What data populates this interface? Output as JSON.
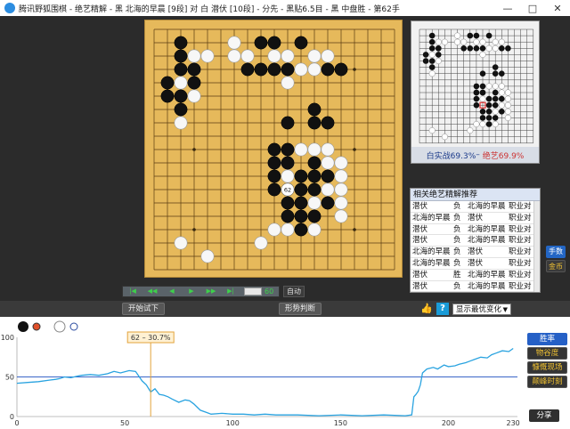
{
  "window": {
    "title": "腾讯野狐围棋 - 绝艺精解 - 黑 北海的早晨 [9段] 对 白 潜伏 [10段] - 分先 - 黑贴6.5目 - 黑 中盘胜 - 第62手",
    "controls": [
      "—",
      "□",
      "✕"
    ]
  },
  "board": {
    "size": 19,
    "star_points": [
      [
        3,
        3
      ],
      [
        3,
        9
      ],
      [
        3,
        15
      ],
      [
        9,
        3
      ],
      [
        9,
        9
      ],
      [
        9,
        15
      ],
      [
        15,
        3
      ],
      [
        15,
        9
      ],
      [
        15,
        15
      ]
    ],
    "black": [
      [
        2,
        1
      ],
      [
        9,
        1
      ],
      [
        2,
        2
      ],
      [
        11,
        1
      ],
      [
        3,
        3
      ],
      [
        2,
        3
      ],
      [
        1,
        4
      ],
      [
        3,
        4
      ],
      [
        1,
        5
      ],
      [
        2,
        5
      ],
      [
        2,
        6
      ],
      [
        7,
        3
      ],
      [
        8,
        3
      ],
      [
        9,
        3
      ],
      [
        10,
        3
      ],
      [
        13,
        3
      ],
      [
        14,
        3
      ],
      [
        12,
        6
      ],
      [
        10,
        7
      ],
      [
        12,
        7
      ],
      [
        13,
        7
      ],
      [
        9,
        9
      ],
      [
        10,
        9
      ],
      [
        9,
        10
      ],
      [
        10,
        10
      ],
      [
        12,
        10
      ],
      [
        9,
        11
      ],
      [
        11,
        11
      ],
      [
        12,
        11
      ],
      [
        13,
        11
      ],
      [
        9,
        12
      ],
      [
        11,
        12
      ],
      [
        12,
        12
      ],
      [
        10,
        13
      ],
      [
        11,
        13
      ],
      [
        11,
        14
      ],
      [
        10,
        14
      ],
      [
        12,
        14
      ],
      [
        13,
        13
      ],
      [
        11,
        15
      ],
      [
        8,
        1
      ]
    ],
    "white": [
      [
        6,
        1
      ],
      [
        3,
        2
      ],
      [
        4,
        2
      ],
      [
        6,
        2
      ],
      [
        7,
        2
      ],
      [
        10,
        2
      ],
      [
        12,
        2
      ],
      [
        3,
        3
      ],
      [
        13,
        2
      ],
      [
        9,
        2
      ],
      [
        11,
        3
      ],
      [
        12,
        3
      ],
      [
        10,
        4
      ],
      [
        2,
        4
      ],
      [
        3,
        5
      ],
      [
        2,
        7
      ],
      [
        9,
        10
      ],
      [
        10,
        10
      ],
      [
        11,
        9
      ],
      [
        12,
        9
      ],
      [
        13,
        9
      ],
      [
        10,
        11
      ],
      [
        13,
        10
      ],
      [
        14,
        10
      ],
      [
        14,
        11
      ],
      [
        14,
        12
      ],
      [
        14,
        13
      ],
      [
        14,
        14
      ],
      [
        12,
        13
      ],
      [
        9,
        15
      ],
      [
        10,
        15
      ],
      [
        12,
        15
      ],
      [
        2,
        16
      ],
      [
        4,
        17
      ],
      [
        8,
        16
      ],
      [
        13,
        12
      ]
    ],
    "last_move": {
      "col": 10,
      "row": 12,
      "number": "62"
    }
  },
  "mini": {
    "winrate_text": "白实战69.3%",
    "separator": " – ",
    "ai_text": "绝艺69.9%"
  },
  "recommend": {
    "title": "相关绝艺精解推荐",
    "rows": [
      [
        "潜伏",
        "负",
        "北海的早晨",
        "职业对"
      ],
      [
        "北海的早晨",
        "负",
        "潜伏",
        "职业对"
      ],
      [
        "潜伏",
        "负",
        "北海的早晨",
        "职业对"
      ],
      [
        "潜伏",
        "负",
        "北海的早晨",
        "职业对"
      ],
      [
        "北海的早晨",
        "负",
        "潜伏",
        "职业对"
      ],
      [
        "北海的早晨",
        "负",
        "潜伏",
        "职业对"
      ],
      [
        "潜伏",
        "胜",
        "北海的早晨",
        "职业对"
      ],
      [
        "潜伏",
        "负",
        "北海的早晨",
        "职业对"
      ]
    ]
  },
  "side_buttons": {
    "hands": "手数",
    "gold": "金币"
  },
  "nav": {
    "buttons": [
      "|◀",
      "◀◀",
      "◀",
      "▶",
      "▶▶",
      "▶|"
    ],
    "move_count": "60",
    "auto": "自动"
  },
  "toolbar": {
    "try_label": "开始试下",
    "judge_label": "形势判断",
    "select_value": "显示最优变化"
  },
  "graph": {
    "marker_label": "62 – 30.7%",
    "y_ticks": [
      "100",
      "50",
      "0"
    ],
    "x_ticks": [
      "0",
      "50",
      "100",
      "150",
      "200",
      "230"
    ],
    "buttons": {
      "winrate": "胜率",
      "target": "物谷度",
      "highlight": "慷慨现场",
      "key": "颠峰时刻",
      "share": "分享"
    }
  },
  "chart_data": {
    "type": "line",
    "title": "",
    "xlabel": "",
    "ylabel": "",
    "xlim": [
      0,
      232
    ],
    "ylim": [
      0,
      100
    ],
    "marker": {
      "move": 62,
      "value": 30.7
    },
    "series": [
      {
        "name": "",
        "x": [
          0,
          5,
          10,
          15,
          18,
          20,
          22,
          25,
          28,
          30,
          34,
          38,
          42,
          45,
          48,
          52,
          55,
          58,
          60,
          62,
          64,
          66,
          68,
          70,
          72,
          75,
          78,
          80,
          82,
          85,
          88,
          90,
          95,
          100,
          105,
          110,
          115,
          120,
          130,
          140,
          150,
          160,
          170,
          180,
          183,
          184,
          185,
          186,
          187,
          188,
          190,
          193,
          195,
          198,
          200,
          203,
          205,
          208,
          210,
          212,
          215,
          218,
          220,
          222,
          225,
          228,
          230
        ],
        "y": [
          42,
          43,
          44,
          46,
          47,
          48,
          50,
          49,
          51,
          52,
          53,
          52,
          54,
          57,
          55,
          58,
          57,
          45,
          40,
          31,
          35,
          28,
          27,
          25,
          22,
          18,
          21,
          20,
          16,
          8,
          5,
          3,
          4,
          3,
          3,
          2,
          3,
          2,
          2,
          1,
          2,
          1,
          2,
          1,
          2,
          25,
          28,
          32,
          40,
          55,
          60,
          62,
          60,
          65,
          63,
          64,
          66,
          68,
          70,
          72,
          75,
          74,
          78,
          80,
          83,
          82,
          86
        ]
      }
    ]
  }
}
